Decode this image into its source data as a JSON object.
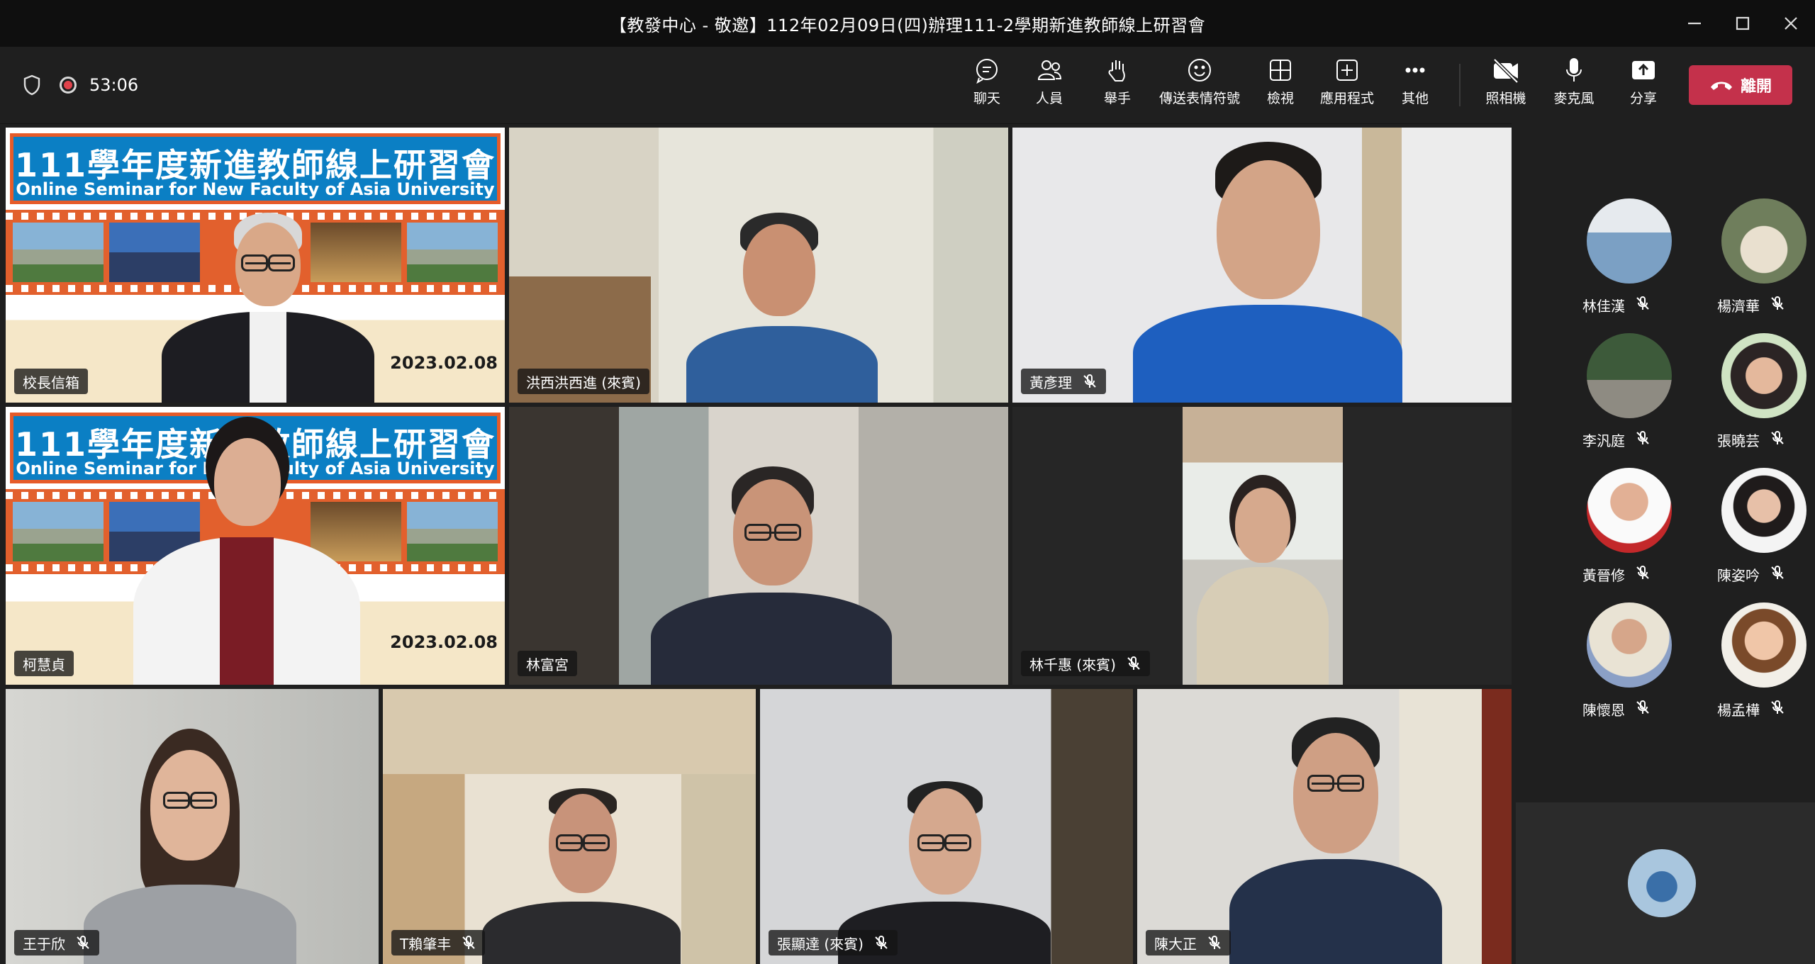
{
  "window": {
    "title": "【教發中心 - 敬邀】112年02月09日(四)辦理111-2學期新進教師線上研習會"
  },
  "toolbar": {
    "timer": "53:06",
    "buttons": [
      {
        "label": "聊天",
        "icon": "chat-icon"
      },
      {
        "label": "人員",
        "icon": "people-icon"
      },
      {
        "label": "舉手",
        "icon": "raise-hand-icon"
      },
      {
        "label": "傳送表情符號",
        "icon": "emoji-icon"
      },
      {
        "label": "檢視",
        "icon": "view-grid-icon"
      },
      {
        "label": "應用程式",
        "icon": "apps-icon"
      },
      {
        "label": "其他",
        "icon": "more-icon"
      },
      {
        "label": "照相機",
        "icon": "camera-off-icon"
      },
      {
        "label": "麥克風",
        "icon": "microphone-icon"
      },
      {
        "label": "分享",
        "icon": "share-icon"
      }
    ],
    "leave_label": "離開"
  },
  "banner": {
    "title": "111學年度新進教師線上研習會",
    "subtitle": "Online Seminar for New Faculty of Asia University",
    "date": "2023.02.08"
  },
  "tiles": [
    {
      "name": "校長信箱",
      "muted": false
    },
    {
      "name": "洪西洪西進 (來賓)",
      "muted": false
    },
    {
      "name": "黃彥理",
      "muted": true
    },
    {
      "name": "柯慧貞",
      "muted": false
    },
    {
      "name": "林富宮",
      "muted": false
    },
    {
      "name": "林千惠 (來賓)",
      "muted": true
    },
    {
      "name": "王于欣",
      "muted": true
    },
    {
      "name": "T賴肇丰",
      "muted": true
    },
    {
      "name": "張顯達 (來賓)",
      "muted": true
    },
    {
      "name": "陳大正",
      "muted": true
    }
  ],
  "roster": [
    {
      "name": "林佳漢",
      "muted": true
    },
    {
      "name": "楊濟華",
      "muted": true
    },
    {
      "name": "李汎庭",
      "muted": true
    },
    {
      "name": "張曉芸",
      "muted": true
    },
    {
      "name": "黃晉修",
      "muted": true
    },
    {
      "name": "陳姿吟",
      "muted": true
    },
    {
      "name": "陳懷恩",
      "muted": true
    },
    {
      "name": "楊孟樺",
      "muted": true
    }
  ],
  "colors": {
    "leave": "#c4314b",
    "record": "#e0424b",
    "banner_blue": "#0b7fc4",
    "banner_orange": "#e2602d"
  }
}
